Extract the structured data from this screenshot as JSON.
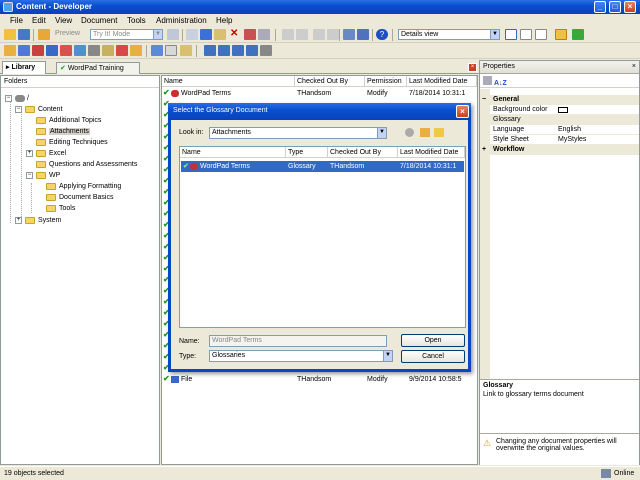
{
  "window": {
    "title": "Content - Developer"
  },
  "menu": [
    "File",
    "Edit",
    "View",
    "Document",
    "Tools",
    "Administration",
    "Help"
  ],
  "toolbar": {
    "preview_label": "Preview",
    "mode_value": "Try It! Mode",
    "view_value": "Details view"
  },
  "tabs": [
    {
      "label": "Library"
    },
    {
      "label": "WordPad Training"
    }
  ],
  "folders": {
    "header": "Folders",
    "items": [
      {
        "label": "/"
      },
      {
        "label": "Content"
      },
      {
        "label": "Additional Topics"
      },
      {
        "label": "Attachments"
      },
      {
        "label": "Editing Techniques"
      },
      {
        "label": "Excel"
      },
      {
        "label": "Questions and Assessments"
      },
      {
        "label": "WP"
      },
      {
        "label": "Applying Formatting"
      },
      {
        "label": "Document Basics"
      },
      {
        "label": "Tools"
      },
      {
        "label": "System"
      }
    ]
  },
  "list": {
    "columns": [
      "Name",
      "Checked Out By",
      "Permission",
      "Last Modified Date"
    ],
    "rows": [
      {
        "name": "WordPad Terms",
        "checked_out_by": "THandsom",
        "permission": "Modify",
        "modified": "7/18/2014 10:31:1"
      },
      {
        "name": "File",
        "checked_out_by": "THandsom",
        "permission": "Modify",
        "modified": "9/9/2014 10:58:5"
      }
    ]
  },
  "properties": {
    "title": "Properties",
    "categories": [
      {
        "name": "General",
        "rows": [
          {
            "key": "Background color",
            "value": ""
          },
          {
            "key": "Glossary",
            "value": ""
          },
          {
            "key": "Language",
            "value": "English"
          },
          {
            "key": "Style Sheet",
            "value": "MyStyles"
          }
        ]
      },
      {
        "name": "Workflow",
        "rows": []
      }
    ],
    "desc_title": "Glossary",
    "desc_text": "Link to glossary terms document",
    "warning": "Changing any document properties will overwrite the original values."
  },
  "status": {
    "left": "19 objects selected",
    "right": "Online"
  },
  "dialog": {
    "title": "Select the Glossary Document",
    "look_in_label": "Look in:",
    "look_in_value": "Attachments",
    "columns": [
      "Name",
      "Type",
      "Checked Out By",
      "Last Modified Date"
    ],
    "rows": [
      {
        "name": "WordPad Terms",
        "type": "Glossary",
        "checked_out_by": "THandsom",
        "modified": "7/18/2014 10:31:1"
      }
    ],
    "name_label": "Name:",
    "name_value": "WordPad Terms",
    "type_label": "Type:",
    "type_value": "Glossaries",
    "open_label": "Open",
    "cancel_label": "Cancel"
  },
  "colors": {
    "titlebar": "#0a4fd0",
    "selection": "#316ac5",
    "check": "#1a9c1a",
    "folder": "#f5d56b"
  }
}
